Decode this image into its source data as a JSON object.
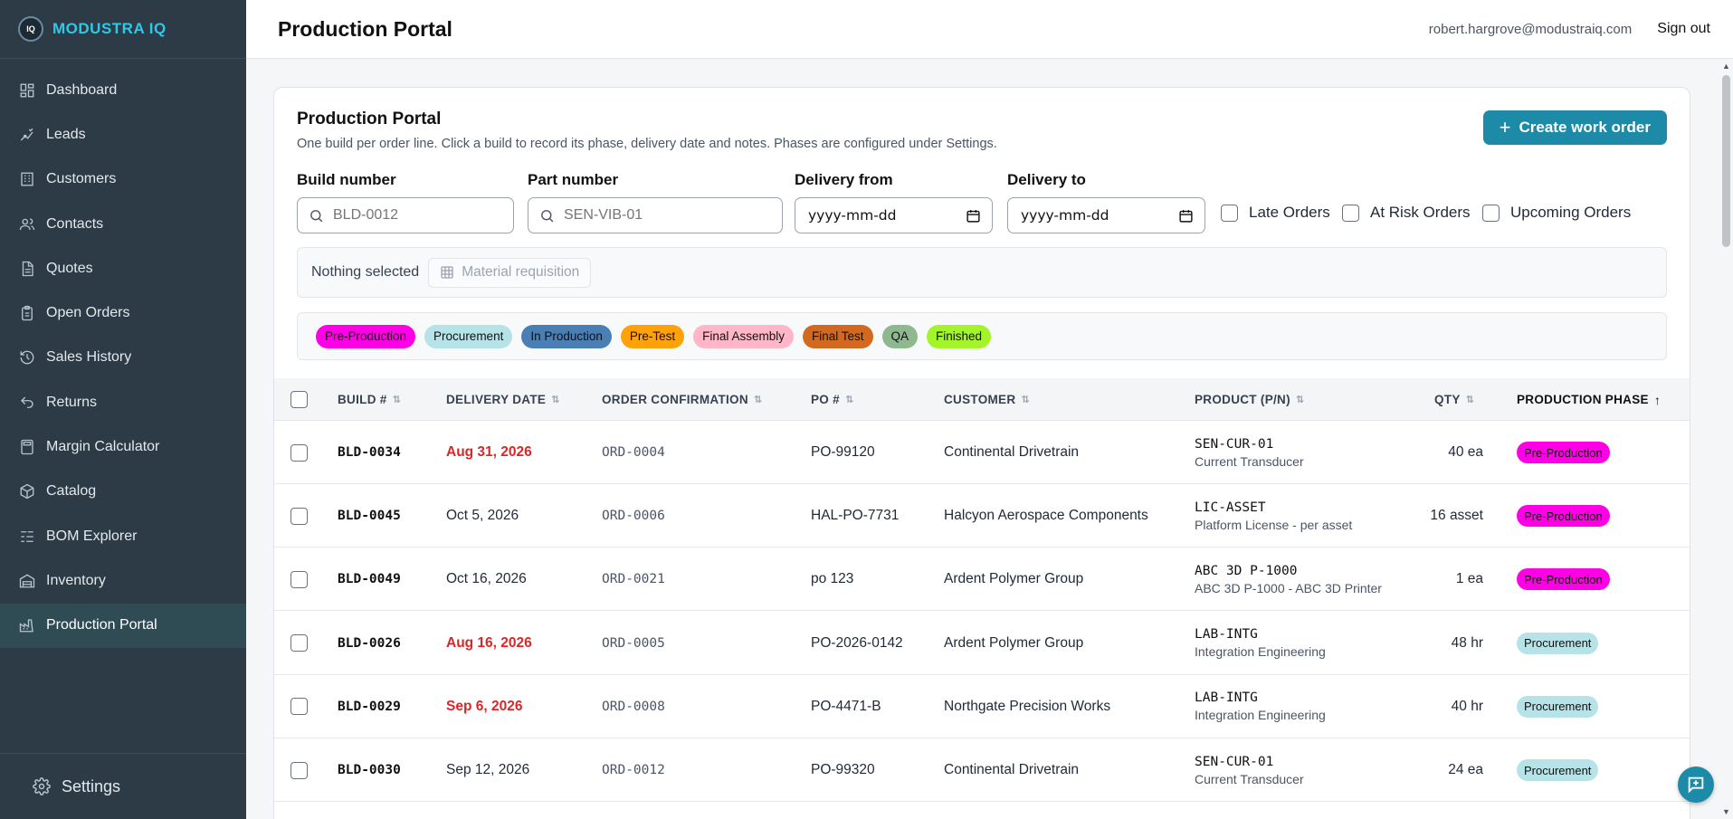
{
  "brand": {
    "name": "MODUSTRA IQ",
    "logo_text": "IQ"
  },
  "sidebar": {
    "items": [
      {
        "label": "Dashboard",
        "icon": "dashboard-icon"
      },
      {
        "label": "Leads",
        "icon": "leads-icon"
      },
      {
        "label": "Customers",
        "icon": "building-icon"
      },
      {
        "label": "Contacts",
        "icon": "people-icon"
      },
      {
        "label": "Quotes",
        "icon": "document-icon"
      },
      {
        "label": "Open Orders",
        "icon": "clipboard-icon"
      },
      {
        "label": "Sales History",
        "icon": "history-icon"
      },
      {
        "label": "Returns",
        "icon": "return-icon"
      },
      {
        "label": "Margin Calculator",
        "icon": "calculator-icon"
      },
      {
        "label": "Catalog",
        "icon": "box-icon"
      },
      {
        "label": "BOM Explorer",
        "icon": "tree-icon"
      },
      {
        "label": "Inventory",
        "icon": "warehouse-icon"
      },
      {
        "label": "Production Portal",
        "icon": "factory-icon",
        "active": true
      }
    ],
    "settings_label": "Settings"
  },
  "header": {
    "title": "Production Portal",
    "user_email": "robert.hargrove@modustraiq.com",
    "sign_out": "Sign out"
  },
  "card": {
    "title": "Production Portal",
    "subtitle": "One build per order line. Click a build to record its phase, delivery date and notes. Phases are configured under Settings.",
    "create_button": "Create work order"
  },
  "filters": {
    "build_label": "Build number",
    "build_placeholder": "BLD-0012",
    "part_label": "Part number",
    "part_placeholder": "SEN-VIB-01",
    "from_label": "Delivery from",
    "from_value": "yyyy-mm-dd",
    "to_label": "Delivery to",
    "to_value": "yyyy-mm-dd",
    "late_label": "Late Orders",
    "risk_label": "At Risk Orders",
    "upcoming_label": "Upcoming Orders"
  },
  "selection": {
    "status": "Nothing selected",
    "material_button": "Material requisition"
  },
  "phases": [
    {
      "label": "Pre-Production",
      "color": "#ff00e6"
    },
    {
      "label": "Procurement",
      "color": "#b5e3e8"
    },
    {
      "label": "In Production",
      "color": "#4a7fb5"
    },
    {
      "label": "Pre-Test",
      "color": "#ffa20a"
    },
    {
      "label": "Final Assembly",
      "color": "#ffb6c8"
    },
    {
      "label": "Final Test",
      "color": "#d2691e"
    },
    {
      "label": "QA",
      "color": "#90b890"
    },
    {
      "label": "Finished",
      "color": "#a3f52a"
    }
  ],
  "table": {
    "columns": [
      "BUILD #",
      "DELIVERY DATE",
      "ORDER CONFIRMATION",
      "PO #",
      "CUSTOMER",
      "PRODUCT (P/N)",
      "QTY",
      "PRODUCTION PHASE"
    ],
    "rows": [
      {
        "build": "BLD-0034",
        "date": "Aug 31, 2026",
        "late": true,
        "order": "ORD-0004",
        "po": "PO-99120",
        "customer": "Continental Drivetrain",
        "pn": "SEN-CUR-01",
        "pdesc": "Current Transducer",
        "qty": "40 ea",
        "phase": "Pre-Production",
        "phase_color": "#ff00e6"
      },
      {
        "build": "BLD-0045",
        "date": "Oct 5, 2026",
        "late": false,
        "order": "ORD-0006",
        "po": "HAL-PO-7731",
        "customer": "Halcyon Aerospace Components",
        "pn": "LIC-ASSET",
        "pdesc": "Platform License - per asset",
        "qty": "16 asset",
        "phase": "Pre-Production",
        "phase_color": "#ff00e6"
      },
      {
        "build": "BLD-0049",
        "date": "Oct 16, 2026",
        "late": false,
        "order": "ORD-0021",
        "po": "po 123",
        "customer": "Ardent Polymer Group",
        "pn": "ABC 3D P-1000",
        "pdesc": "ABC 3D P-1000 - ABC 3D Printer",
        "qty": "1 ea",
        "phase": "Pre-Production",
        "phase_color": "#ff00e6"
      },
      {
        "build": "BLD-0026",
        "date": "Aug 16, 2026",
        "late": true,
        "order": "ORD-0005",
        "po": "PO-2026-0142",
        "customer": "Ardent Polymer Group",
        "pn": "LAB-INTG",
        "pdesc": "Integration Engineering",
        "qty": "48 hr",
        "phase": "Procurement",
        "phase_color": "#b5e3e8"
      },
      {
        "build": "BLD-0029",
        "date": "Sep 6, 2026",
        "late": true,
        "order": "ORD-0008",
        "po": "PO-4471-B",
        "customer": "Northgate Precision Works",
        "pn": "LAB-INTG",
        "pdesc": "Integration Engineering",
        "qty": "40 hr",
        "phase": "Procurement",
        "phase_color": "#b5e3e8"
      },
      {
        "build": "BLD-0030",
        "date": "Sep 12, 2026",
        "late": false,
        "order": "ORD-0012",
        "po": "PO-99320",
        "customer": "Continental Drivetrain",
        "pn": "SEN-CUR-01",
        "pdesc": "Current Transducer",
        "qty": "24 ea",
        "phase": "Procurement",
        "phase_color": "#b5e3e8"
      }
    ]
  },
  "colors": {
    "sidebar_bg": "#2c3b45",
    "accent": "#1d8aa8",
    "brand_text": "#2fc8e8",
    "late_text": "#dc2626"
  }
}
